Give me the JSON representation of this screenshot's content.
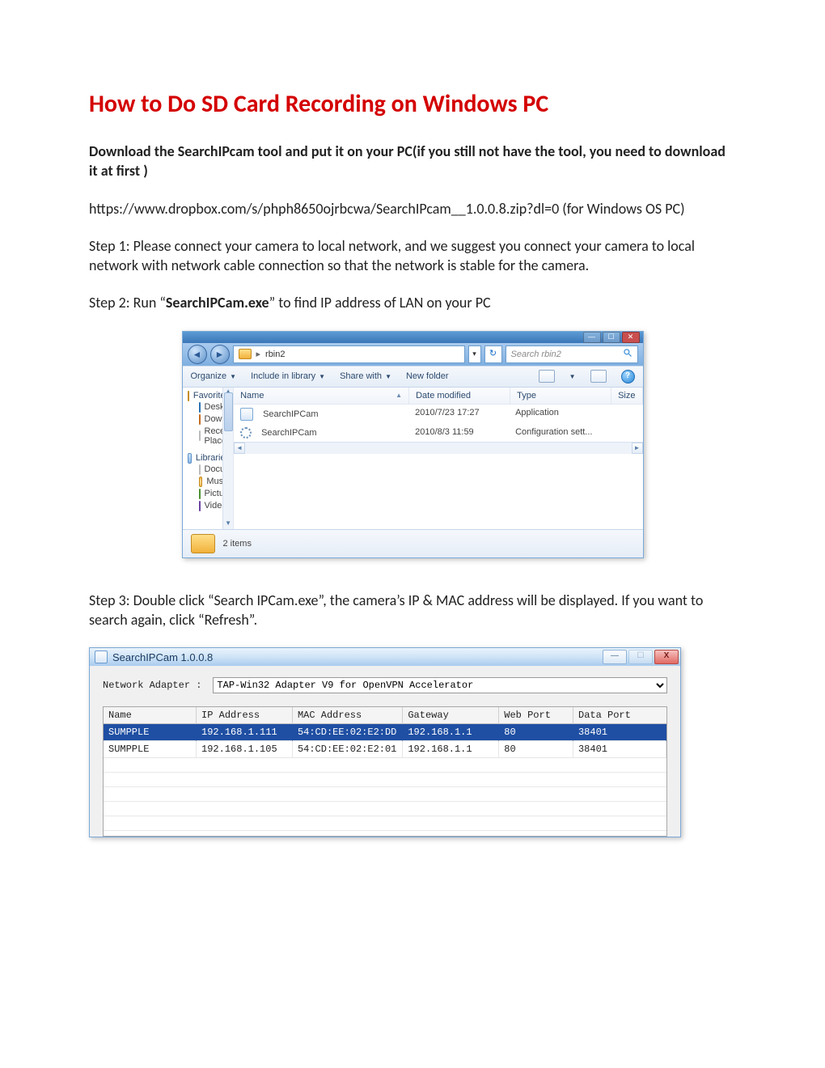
{
  "doc": {
    "title": "How to Do SD Card Recording on Windows PC",
    "intro_bold": "Download the SearchIPcam tool and put it on your PC(if you still not have the tool, you need to download it at first )",
    "link": "https://www.dropbox.com/s/phph8650ojrbcwa/SearchIPcam__1.0.0.8.zip?dl=0  (for Windows OS PC)",
    "step1": "Step 1:  Please connect your camera to local network, and we suggest you connect your camera to local network with network cable connection so that the network is stable for the camera.",
    "step2_a": "Step 2: Run “",
    "step2_bold": "SearchIPCam.exe",
    "step2_b": "” to find IP address of LAN on your PC",
    "step3": "Step 3: Double click “Search IPCam.exe”, the camera’s IP & MAC address will be displayed. If you want to search again, click “Refresh”."
  },
  "explorer": {
    "path_segment": "rbin2",
    "search_placeholder": "Search rbin2",
    "toolbar": {
      "organize": "Organize",
      "include": "Include in library",
      "share": "Share with",
      "newfolder": "New folder"
    },
    "side": {
      "favorites": "Favorites",
      "desktop": "Desktop",
      "downloads": "Downloads",
      "recent": "Recent Places",
      "libraries": "Libraries",
      "documents": "Documents",
      "music": "Music",
      "pictures": "Pictures",
      "videos": "Videos"
    },
    "columns": {
      "name": "Name",
      "date": "Date modified",
      "type": "Type",
      "size": "Size"
    },
    "rows": [
      {
        "name": "SearchIPCam",
        "date": "2010/7/23 17:27",
        "type": "Application"
      },
      {
        "name": "SearchIPCam",
        "date": "2010/8/3 11:59",
        "type": "Configuration sett..."
      }
    ],
    "status": "2 items"
  },
  "ipcam": {
    "title": "SearchIPCam 1.0.0.8",
    "adapter_label": "Network Adapter :",
    "adapter_value": "TAP-Win32 Adapter V9 for OpenVPN Accelerator",
    "columns": {
      "name": "Name",
      "ip": "IP Address",
      "mac": "MAC Address",
      "gw": "Gateway",
      "wp": "Web Port",
      "dp": "Data Port"
    },
    "rows": [
      {
        "name": "SUMPPLE",
        "ip": "192.168.1.111",
        "mac": "54:CD:EE:02:E2:DD",
        "gw": "192.168.1.1",
        "wp": "80",
        "dp": "38401",
        "selected": true
      },
      {
        "name": "SUMPPLE",
        "ip": "192.168.1.105",
        "mac": "54:CD:EE:02:E2:01",
        "gw": "192.168.1.1",
        "wp": "80",
        "dp": "38401",
        "selected": false
      }
    ]
  }
}
